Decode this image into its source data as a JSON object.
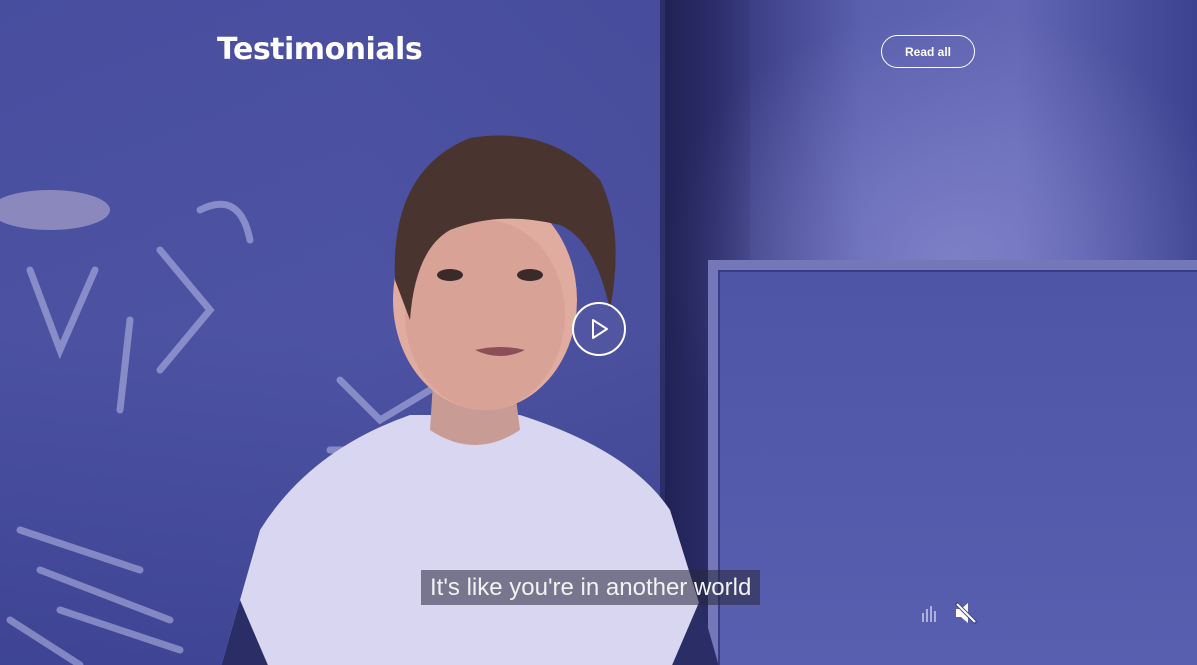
{
  "header": {
    "title": "Testimonials",
    "read_all_label": "Read all"
  },
  "video": {
    "subtitle": "It's like you're in another world",
    "state": "paused",
    "muted": true
  },
  "colors": {
    "accent": "#ffffff",
    "background": "#3b3f8f"
  },
  "icons": {
    "play": "play-icon",
    "audio_levels": "audio-bars-icon",
    "mute": "muted-speaker-icon"
  }
}
